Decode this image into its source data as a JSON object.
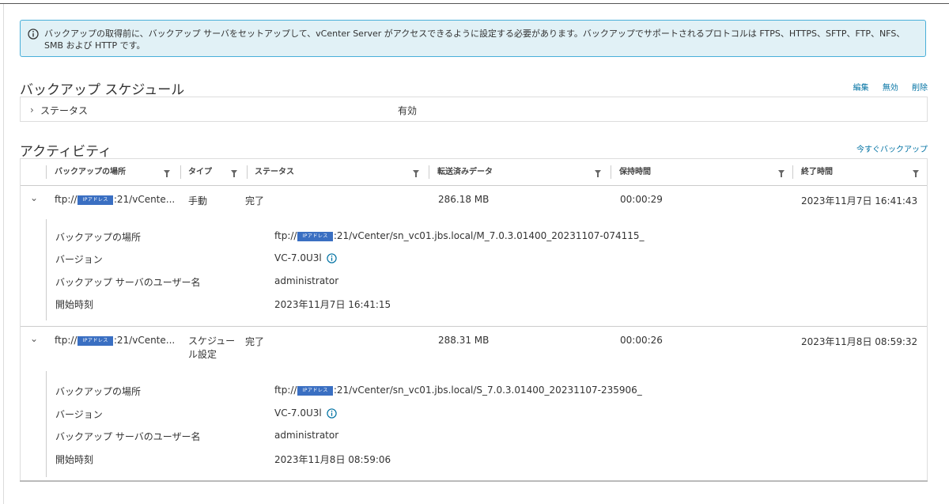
{
  "alert": {
    "icon": "info-circle-icon",
    "text": "バックアップの取得前に、バックアップ サーバをセットアップして、vCenter Server がアクセスできるように設定する必要があります。バックアップでサポートされるプロトコルは FTPS、HTTPS、SFTP、FTP、NFS、SMB および HTTP です。"
  },
  "schedule": {
    "title": "バックアップ スケジュール",
    "actions": {
      "edit": "編集",
      "disable": "無効",
      "delete": "削除"
    },
    "status_label": "ステータス",
    "status_value": "有効"
  },
  "activity": {
    "title": "アクティビティ",
    "backup_now": "今すぐバックアップ",
    "columns": [
      "バックアップの場所",
      "タイプ",
      "ステータス",
      "転送済みデータ",
      "保持時間",
      "終了時間"
    ],
    "ip_badge": "IPアドレス",
    "detail_labels": {
      "location": "バックアップの場所",
      "version": "バージョン",
      "user": "バックアップ サーバのユーザー名",
      "start": "開始時刻"
    },
    "rows": [
      {
        "loc_prefix": "ftp://",
        "loc_suffix": ":21/vCente...",
        "type": "手動",
        "status": "完了",
        "data": "286.18 MB",
        "duration": "00:00:29",
        "end": "2023年11月7日 16:41:43",
        "detail": {
          "loc_prefix": "ftp://",
          "loc_suffix": ":21/vCenter/sn_vc01.jbs.local/M_7.0.3.01400_20231107-074115_",
          "version": "VC-7.0U3l",
          "user": "administrator",
          "start": "2023年11月7日 16:41:15"
        }
      },
      {
        "loc_prefix": "ftp://",
        "loc_suffix": ":21/vCente...",
        "type_line1": "スケジュー",
        "type_line2": "ル設定",
        "status": "完了",
        "data": "288.31 MB",
        "duration": "00:00:26",
        "end": "2023年11月8日 08:59:32",
        "detail": {
          "loc_prefix": "ftp://",
          "loc_suffix": ":21/vCenter/sn_vc01.jbs.local/S_7.0.3.01400_20231107-235906_",
          "version": "VC-7.0U3l",
          "user": "administrator",
          "start": "2023年11月8日 08:59:06"
        }
      }
    ]
  },
  "colors": {
    "link": "#0072a3",
    "alert_border": "#49afd9",
    "alert_bg": "#e1f1f6",
    "badge": "#3a6fc2"
  }
}
